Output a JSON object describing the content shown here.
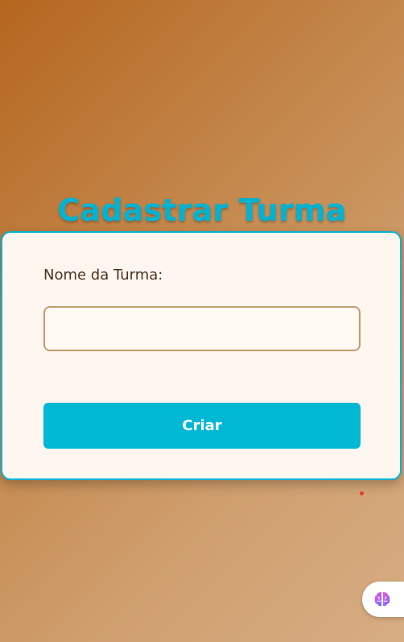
{
  "page": {
    "title": "Cadastrar Turma"
  },
  "form": {
    "name_label": "Nome da Turma:",
    "name_value": "",
    "name_placeholder": "",
    "submit_label": "Criar"
  },
  "colors": {
    "accent": "#00b3d3",
    "button": "#00b8d4",
    "card_background": "#fdf7f0",
    "input_border": "#c49a6c",
    "label_text": "#4d3420"
  },
  "icons": {
    "floating_button": "brain-icon"
  }
}
